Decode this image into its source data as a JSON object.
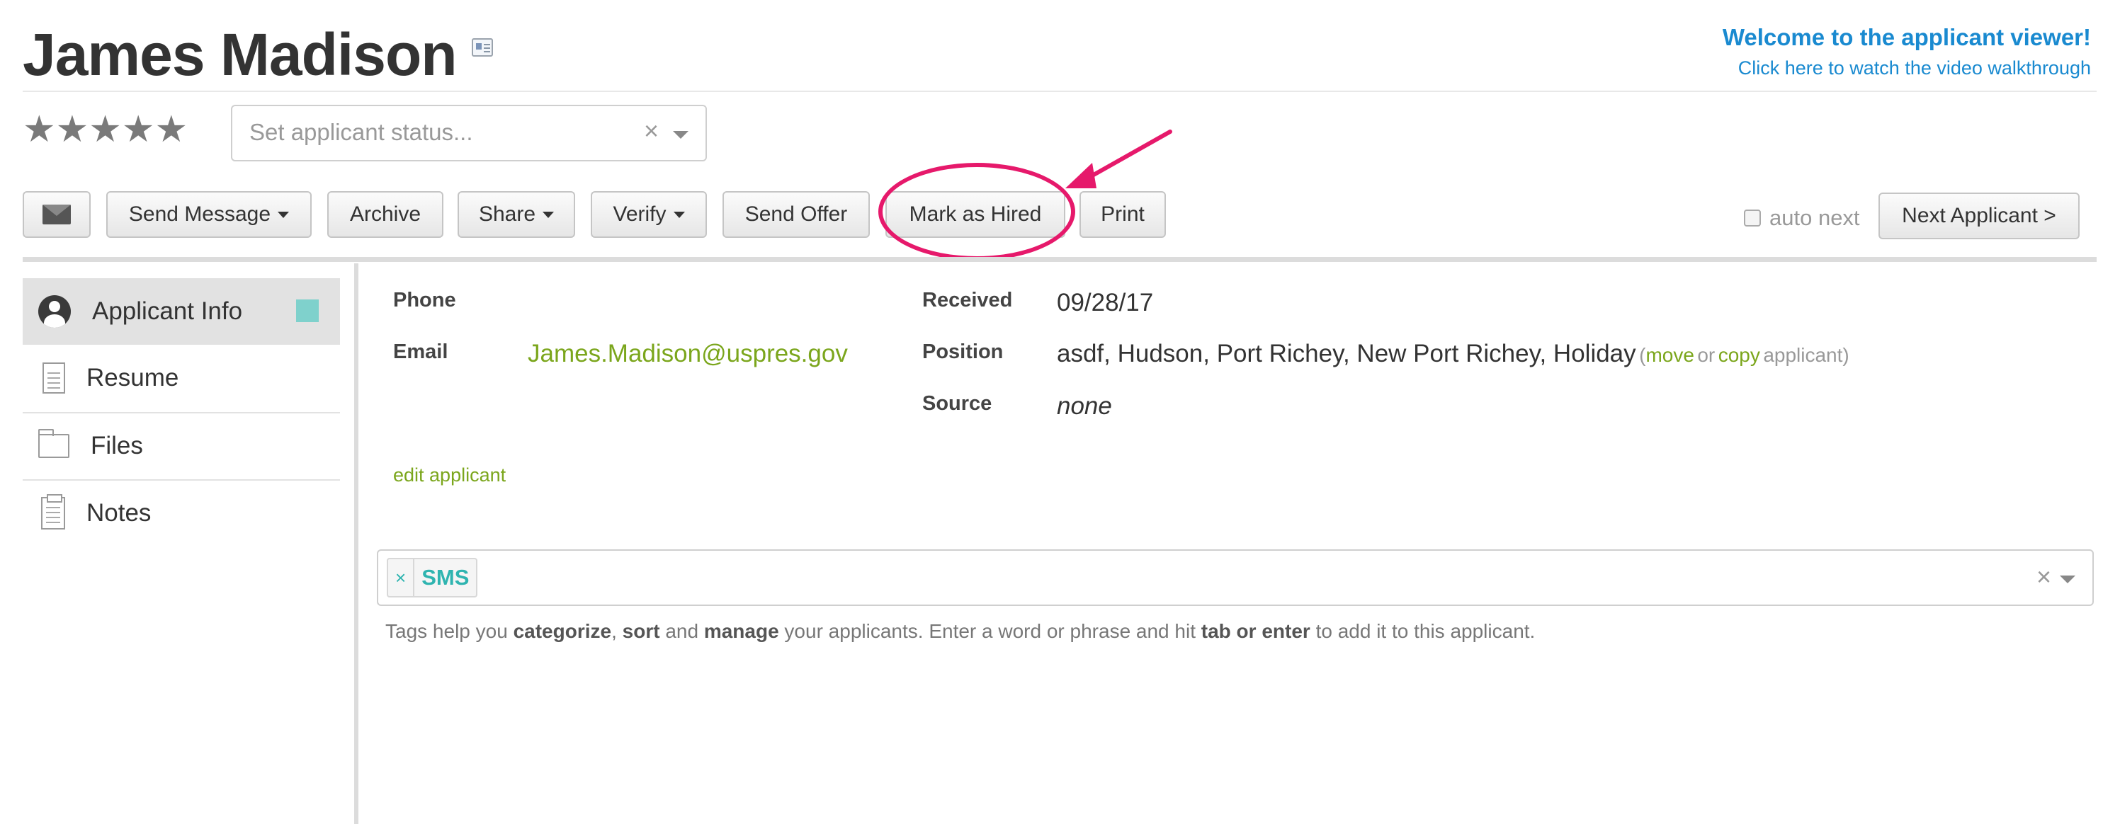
{
  "header": {
    "applicant_name": "James Madison",
    "welcome_title": "Welcome to the applicant viewer!",
    "welcome_link": "Click here to watch the video walkthrough"
  },
  "rating": {
    "stars_text": "★★★★★",
    "value": 0,
    "max": 5
  },
  "status": {
    "placeholder": "Set applicant status...",
    "clear": "×"
  },
  "toolbar": {
    "send_message": "Send Message",
    "archive": "Archive",
    "share": "Share",
    "verify": "Verify",
    "send_offer": "Send Offer",
    "mark_as_hired": "Mark as Hired",
    "print": "Print",
    "auto_next": "auto next",
    "next_applicant": "Next Applicant >"
  },
  "sidebar": {
    "items": [
      {
        "label": "Applicant Info",
        "icon": "user-icon",
        "active": true
      },
      {
        "label": "Resume",
        "icon": "document-icon"
      },
      {
        "label": "Files",
        "icon": "folder-icon"
      },
      {
        "label": "Notes",
        "icon": "notes-icon"
      }
    ]
  },
  "info": {
    "phone_label": "Phone",
    "phone_value": "",
    "email_label": "Email",
    "email_value": "James.Madison@uspres.gov",
    "received_label": "Received",
    "received_value": "09/28/17",
    "position_label": "Position",
    "position_value": "asdf, Hudson, Port Richey, New Port Richey, Holiday",
    "position_actions": {
      "open": "(",
      "move": "move",
      "or": "or",
      "copy": "copy",
      "applicant": "applicant)"
    },
    "source_label": "Source",
    "source_value": "none",
    "edit_link": "edit applicant"
  },
  "tags": {
    "items": [
      "SMS"
    ],
    "remove_symbol": "×",
    "clear": "×",
    "help": {
      "p1": "Tags help you ",
      "b1": "categorize",
      "p2": ", ",
      "b2": "sort",
      "p3": " and ",
      "b3": "manage",
      "p4": " your applicants. Enter a word or phrase and hit ",
      "b4": "tab or enter",
      "p5": " to add it to this applicant."
    }
  },
  "colors": {
    "accent_blue": "#1a8ad0",
    "link_green": "#7ba61c",
    "tag_teal": "#2fb4b0",
    "highlight_pink": "#e6196b"
  }
}
